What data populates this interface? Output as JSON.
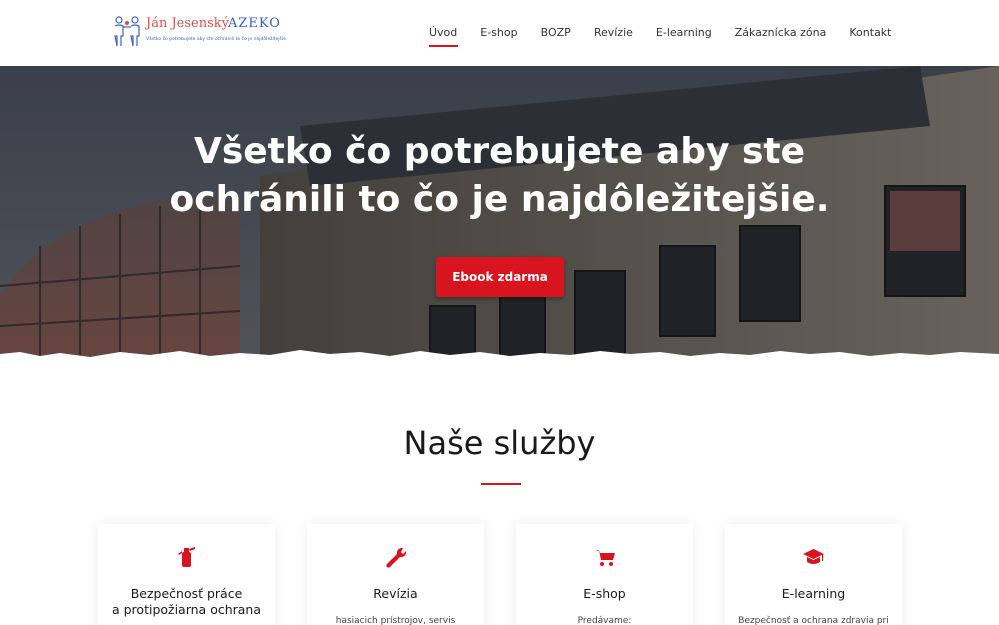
{
  "header": {
    "logo": {
      "name": "Ján Jesenský",
      "brand": "AZEKO",
      "tagline": "Všetko čo potrebujete aby ste ochránili to čo je najdôležitejšie."
    },
    "nav": [
      {
        "label": "Úvod",
        "active": true
      },
      {
        "label": "E-shop"
      },
      {
        "label": "BOZP"
      },
      {
        "label": "Revízie"
      },
      {
        "label": "E-learning"
      },
      {
        "label": "Zákaznícka zóna"
      },
      {
        "label": "Kontakt"
      }
    ]
  },
  "hero": {
    "title_line1": "Všetko čo potrebujete aby ste",
    "title_line2": "ochránili to čo je najdôležitejšie.",
    "cta_label": "Ebook zdarma"
  },
  "services": {
    "title": "Naše služby",
    "cards": [
      {
        "icon": "fire-extinguisher-icon",
        "title_line1": "Bezpečnosť práce",
        "title_line2": "a protipožiarna ochrana",
        "text": ""
      },
      {
        "icon": "wrench-icon",
        "title_line1": "Revízia",
        "title_line2": "",
        "text": "hasiacich prístrojov, servis"
      },
      {
        "icon": "cart-icon",
        "title_line1": "E-shop",
        "title_line2": "",
        "text": "Predávame:"
      },
      {
        "icon": "graduation-cap-icon",
        "title_line1": "E-learning",
        "title_line2": "",
        "text": "Bezpečnosť a ochrana zdravia pri"
      }
    ]
  },
  "colors": {
    "accent": "#d8141f",
    "logo_red": "#e34b4b",
    "logo_blue": "#2f5fc7"
  }
}
